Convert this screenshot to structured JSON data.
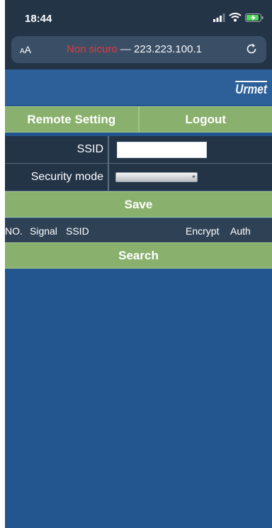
{
  "status_bar": {
    "time": "18:44"
  },
  "browser": {
    "text_size_label_small": "A",
    "text_size_label_large": "A",
    "security_warning": "Non sicuro",
    "separator": " — ",
    "host": "223.223.100.1"
  },
  "page": {
    "logo": "Urmet",
    "nav": {
      "remote_setting": "Remote Setting",
      "logout": "Logout"
    },
    "form": {
      "ssid_label": "SSID",
      "ssid_value": "",
      "security_mode_label": "Security mode",
      "security_mode_value": ""
    },
    "save_label": "Save",
    "table": {
      "headers": [
        "NO.",
        "Signal",
        "SSID",
        "Encrypt",
        "Auth"
      ]
    },
    "search_label": "Search"
  },
  "colors": {
    "page_background": "#23558f",
    "button_green": "#89b16d",
    "dark_panel": "#233446",
    "browser_chrome": "#243447",
    "warning_red": "#e0393e"
  }
}
